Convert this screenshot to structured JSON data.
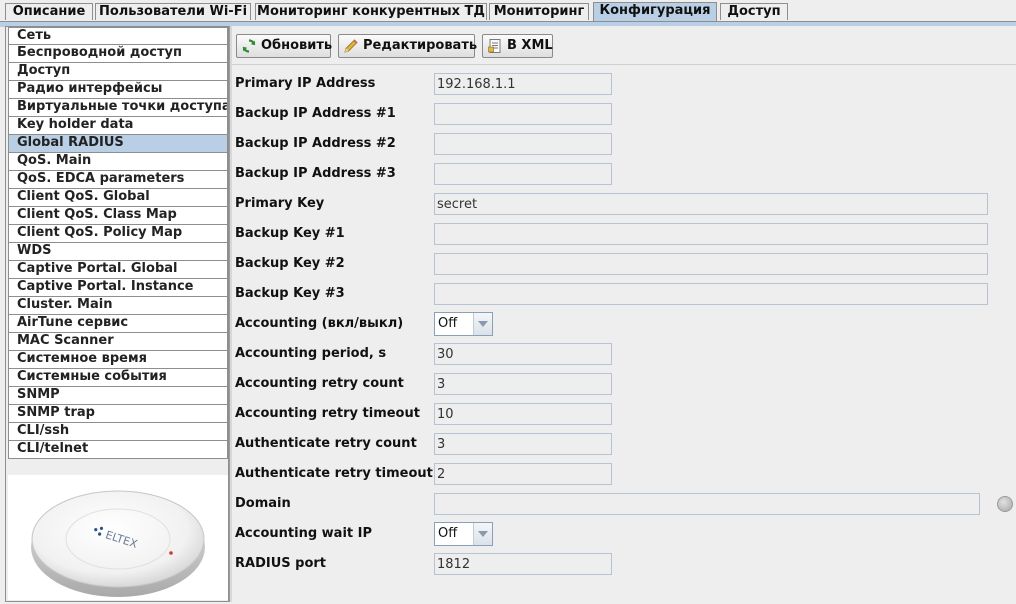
{
  "tabs": [
    {
      "label": "Описание"
    },
    {
      "label": "Пользователи Wi-Fi"
    },
    {
      "label": "Мониторинг конкурентных ТД"
    },
    {
      "label": "Мониторинг"
    },
    {
      "label": "Конфигурация",
      "active": true
    },
    {
      "label": "Доступ"
    }
  ],
  "sidebar": {
    "items": [
      {
        "label": "Сеть"
      },
      {
        "label": "Беспроводной доступ"
      },
      {
        "label": "Доступ"
      },
      {
        "label": "Радио интерфейсы"
      },
      {
        "label": "Виртуальные точки доступа"
      },
      {
        "label": "Key holder data"
      },
      {
        "label": "Global RADIUS",
        "active": true
      },
      {
        "label": "QoS. Main"
      },
      {
        "label": "QoS. EDCA parameters"
      },
      {
        "label": "Client QoS. Global"
      },
      {
        "label": "Client QoS. Class Map"
      },
      {
        "label": "Client QoS. Policy Map"
      },
      {
        "label": "WDS"
      },
      {
        "label": "Captive Portal. Global"
      },
      {
        "label": "Captive Portal. Instance"
      },
      {
        "label": "Cluster. Main"
      },
      {
        "label": "AirTune сервис"
      },
      {
        "label": "MAC Scanner"
      },
      {
        "label": "Системное время"
      },
      {
        "label": "Системные события"
      },
      {
        "label": "SNMP"
      },
      {
        "label": "SNMP trap"
      },
      {
        "label": "CLI/ssh"
      },
      {
        "label": "CLI/telnet"
      }
    ],
    "device_logo_text": "ELTEX"
  },
  "toolbar": {
    "refresh_label": "Обновить",
    "edit_label": "Редактировать",
    "xml_label": "В XML"
  },
  "form": {
    "primary_ip": {
      "label": "Primary IP Address",
      "value": "192.168.1.1"
    },
    "backup_ip_1": {
      "label": "Backup IP Address #1",
      "value": ""
    },
    "backup_ip_2": {
      "label": "Backup IP Address #2",
      "value": ""
    },
    "backup_ip_3": {
      "label": "Backup IP Address #3",
      "value": ""
    },
    "primary_key": {
      "label": "Primary Key",
      "value": "secret"
    },
    "backup_key_1": {
      "label": "Backup Key #1",
      "value": ""
    },
    "backup_key_2": {
      "label": "Backup Key #2",
      "value": ""
    },
    "backup_key_3": {
      "label": "Backup Key #3",
      "value": ""
    },
    "accounting": {
      "label": "Accounting (вкл/выкл)",
      "value": "Off"
    },
    "accounting_period": {
      "label": "Accounting period, s",
      "value": "30"
    },
    "accounting_retry_count": {
      "label": "Accounting retry count",
      "value": "3"
    },
    "accounting_retry_timeout": {
      "label": "Accounting retry timeout",
      "value": "10"
    },
    "auth_retry_count": {
      "label": "Authenticate retry count",
      "value": "3"
    },
    "auth_retry_timeout": {
      "label": "Authenticate retry timeout",
      "value": "2"
    },
    "domain": {
      "label": "Domain",
      "value": ""
    },
    "accounting_wait_ip": {
      "label": "Accounting wait IP",
      "value": "Off"
    },
    "radius_port": {
      "label": "RADIUS port",
      "value": "1812"
    }
  }
}
